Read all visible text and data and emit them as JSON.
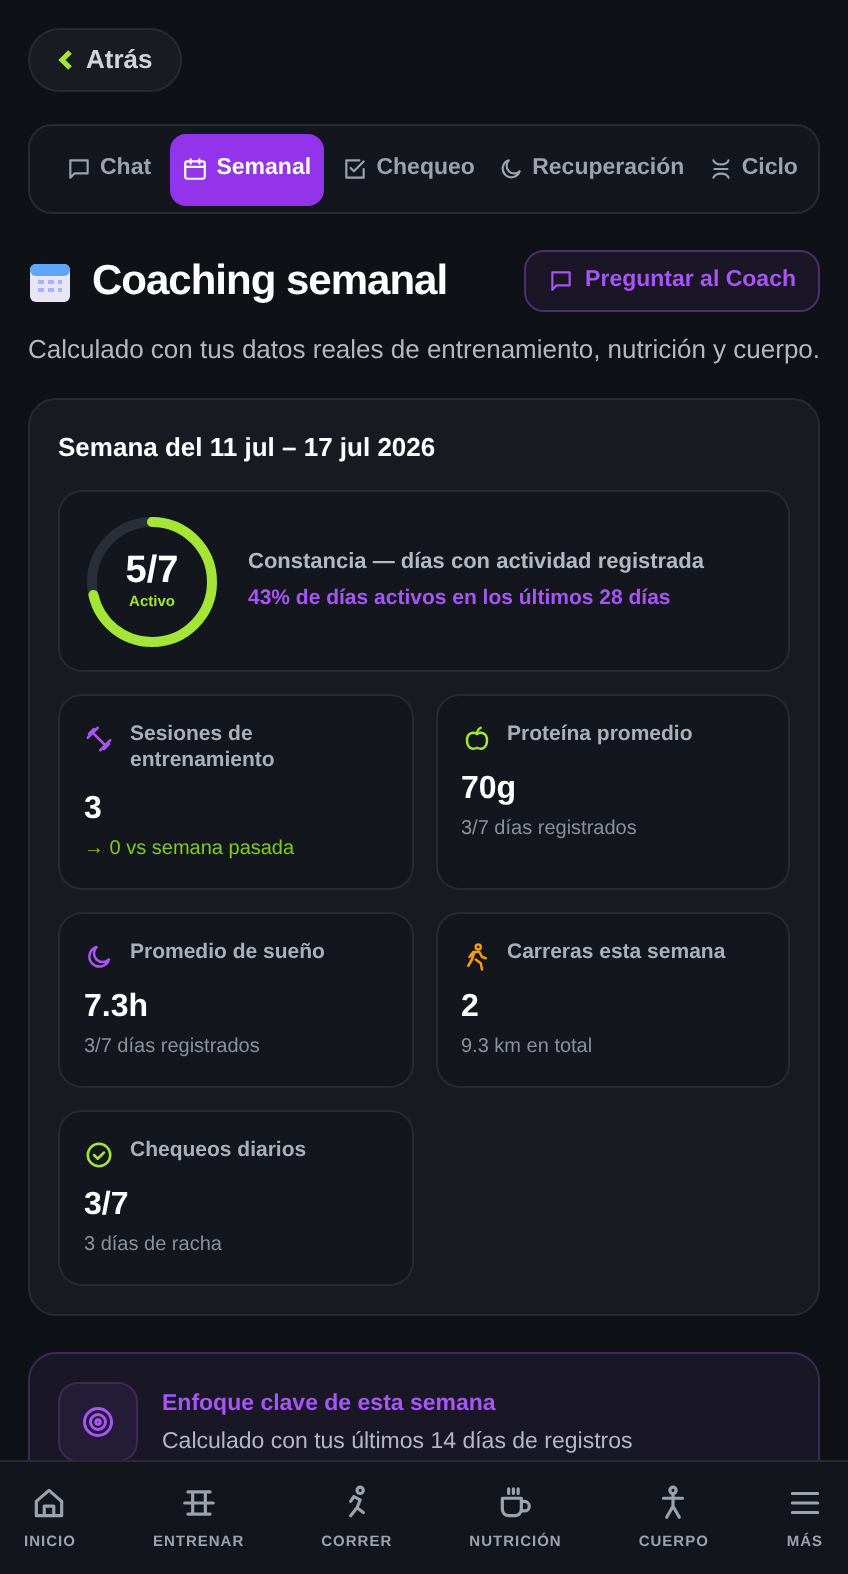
{
  "back_button": {
    "label": "Atrás"
  },
  "tabs": [
    {
      "label": "Chat",
      "selected": false
    },
    {
      "label": "Semanal",
      "selected": true
    },
    {
      "label": "Chequeo",
      "selected": false
    },
    {
      "label": "Recuperación",
      "selected": false
    },
    {
      "label": "Ciclo",
      "selected": false
    }
  ],
  "header": {
    "title": "Coaching semanal",
    "ask_button": "Preguntar al Coach",
    "subtitle": "Calculado con tus datos reales de entrenamiento, nutrición y cuerpo."
  },
  "week": {
    "title": "Semana del 11 jul – 17 jul 2026",
    "consistency": {
      "value": "5/7",
      "status": "Activo",
      "level": 0.714,
      "label": "Constancia — días con actividad registrada",
      "detail": "43% de días activos en los últimos 28 días"
    },
    "stats": [
      {
        "kind": "training",
        "label": "Sesiones de entrenamiento",
        "value": "3",
        "note": "→ 0 vs semana pasada",
        "highlight": true
      },
      {
        "kind": "protein",
        "label": "Proteína promedio",
        "value": "70g",
        "note": "3/7 días registrados",
        "highlight": false
      },
      {
        "kind": "sleep",
        "label": "Promedio de sueño",
        "value": "7.3h",
        "note": "3/7 días registrados",
        "highlight": false
      },
      {
        "kind": "runs",
        "label": "Carreras esta semana",
        "value": "2",
        "note": "9.3 km en total",
        "highlight": false
      },
      {
        "kind": "checkins",
        "label": "Chequeos diarios",
        "value": "3/7",
        "note": "3 días de racha",
        "highlight": false
      }
    ]
  },
  "focus": {
    "title": "Enfoque clave de esta semana",
    "subtitle": "Calculado con tus últimos 14 días de registros"
  },
  "bottom_nav": [
    {
      "label": "INICIO"
    },
    {
      "label": "ENTRENAR"
    },
    {
      "label": "CORRER"
    },
    {
      "label": "NUTRICIÓN"
    },
    {
      "label": "CUERPO"
    },
    {
      "label": "MÁS"
    }
  ]
}
